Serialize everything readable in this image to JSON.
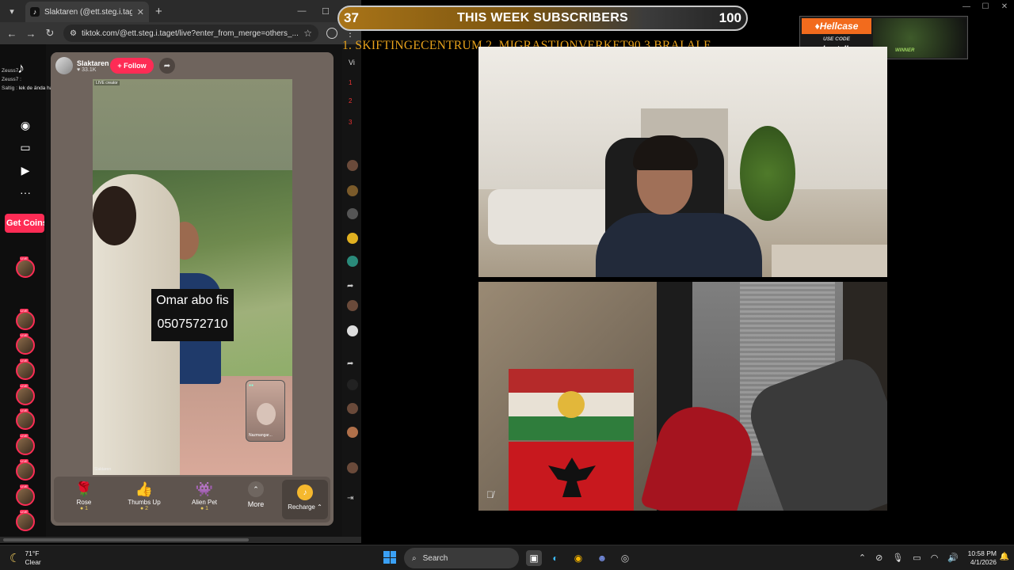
{
  "browser": {
    "tab_title": "Slaktaren (@ett.steg.i.taget",
    "tab_favicon": "tiktok-icon",
    "url": "tiktok.com/@ett.steg.i.taget/live?enter_from_merge=others_...",
    "window_controls": [
      "—",
      "☐",
      "✕"
    ]
  },
  "tiktok": {
    "chat": [
      {
        "user": "Zeuss7",
        "text": ""
      },
      {
        "user": "Zeuss7 :",
        "text": ""
      },
      {
        "user": "Saltig :",
        "text": "lek de ända har gjort e ksos med du vet vad"
      }
    ],
    "get_coins": "Get Coins",
    "host": {
      "name": "Slaktaren",
      "likes": "33.1K"
    },
    "follow_label": "+ Follow",
    "video_label": "LIVE creator",
    "video_watermark": "Slaktaren",
    "caption_line1": "Omar abo fis",
    "caption_line2": "0507572710",
    "pip_name": "Nazmangar...",
    "gifts": [
      {
        "name": "Rose",
        "price": "1",
        "icon": "🌹"
      },
      {
        "name": "Thumbs Up",
        "price": "2",
        "icon": "👍"
      },
      {
        "name": "Alien Pet",
        "price": "1",
        "icon": "👾"
      }
    ],
    "more_label": "More",
    "recharge_label": "Recharge",
    "rightcol_label": "Vi",
    "rightcol_ranks": [
      "1",
      "2",
      "3"
    ]
  },
  "overlay": {
    "sub_count": "37",
    "sub_title": "THIS WEEK SUBSCRIBERS",
    "sub_goal": "100",
    "ticker": "1. SKIFTINGECENTRUM  2. MIGRASTIONVERKET90 3.BRAI ALE",
    "sponsor_brand": "Hellcase",
    "sponsor_usecode": "USE CODE",
    "sponsor_code": "ghostalby",
    "sponsor_winner": "WINNER"
  },
  "taskbar": {
    "temp": "71°F",
    "condition": "Clear",
    "search_label": "Search",
    "time": "10:58 PM",
    "date": "4/1/2026"
  }
}
